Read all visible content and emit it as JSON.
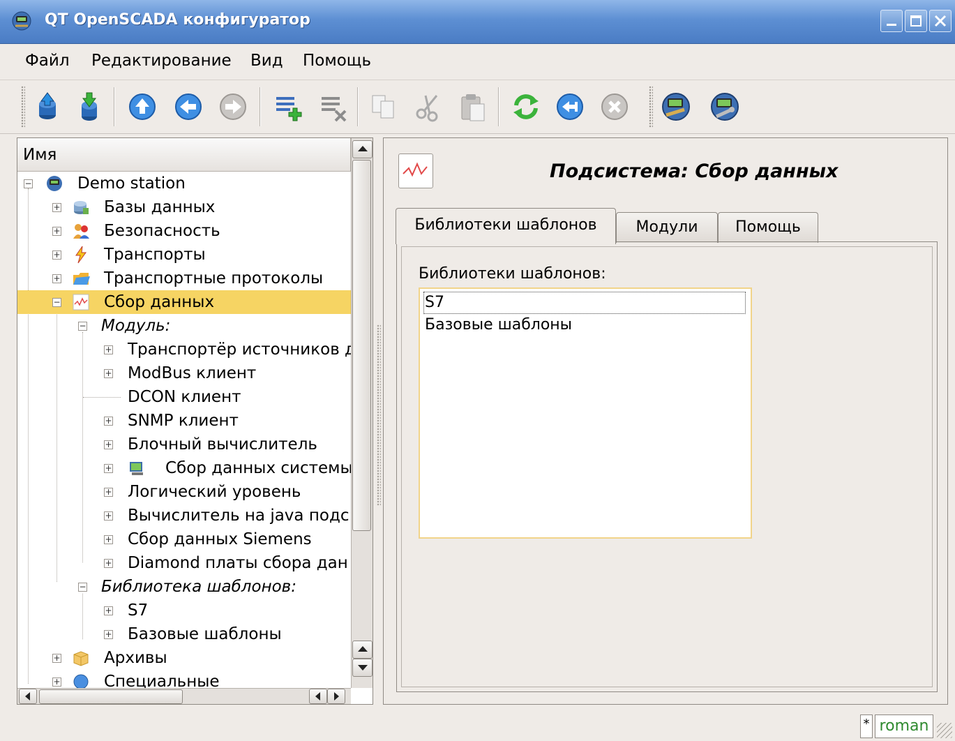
{
  "window": {
    "title": "QT OpenSCADA конфигуратор"
  },
  "menu": [
    {
      "label": "Файл"
    },
    {
      "label": "Редактирование"
    },
    {
      "label": "Вид"
    },
    {
      "label": "Помощь"
    }
  ],
  "toolbar": {
    "icons": [
      "db-load-icon",
      "db-save-icon",
      "up-icon",
      "back-icon",
      "forward-icon",
      "add-item-icon",
      "delete-item-icon",
      "copy-icon",
      "cut-icon",
      "paste-icon",
      "refresh-icon",
      "start-icon",
      "stop-icon",
      "station-icon",
      "station-settings-icon"
    ]
  },
  "tree": {
    "header": "Имя",
    "items": [
      {
        "label": "Demo station"
      },
      {
        "label": "Базы данных"
      },
      {
        "label": "Безопасность"
      },
      {
        "label": "Транспорты"
      },
      {
        "label": "Транспортные протоколы"
      },
      {
        "label": "Сбор данных"
      },
      {
        "label": "Модуль:"
      },
      {
        "label": "Транспортёр источников д"
      },
      {
        "label": "ModBus клиент"
      },
      {
        "label": "DCON клиент"
      },
      {
        "label": "SNMP клиент"
      },
      {
        "label": "Блочный вычислитель"
      },
      {
        "label": "Сбор данных системы"
      },
      {
        "label": "Логический уровень"
      },
      {
        "label": "Вычислитель на java подс"
      },
      {
        "label": "Сбор данных Siemens"
      },
      {
        "label": "Diamond платы сбора дан"
      },
      {
        "label": "Библиотека шаблонов:"
      },
      {
        "label": "S7"
      },
      {
        "label": "Базовые шаблоны"
      },
      {
        "label": "Архивы"
      },
      {
        "label": "Специальные"
      }
    ],
    "selected": "Сбор данных"
  },
  "page": {
    "title": "Подсистема: Сбор данных",
    "tabs": [
      {
        "label": "Библиотеки шаблонов",
        "active": true
      },
      {
        "label": "Модули",
        "active": false
      },
      {
        "label": "Помощь",
        "active": false
      }
    ],
    "list_label": "Библиотеки шаблонов:",
    "list_items": [
      "S7",
      "Базовые шаблоны"
    ]
  },
  "status": {
    "modified": "*",
    "user": "roman"
  },
  "colors": {
    "selection": "#f6d463",
    "titlebar": "#5d8fd3",
    "user_text": "#2f8a2f"
  }
}
